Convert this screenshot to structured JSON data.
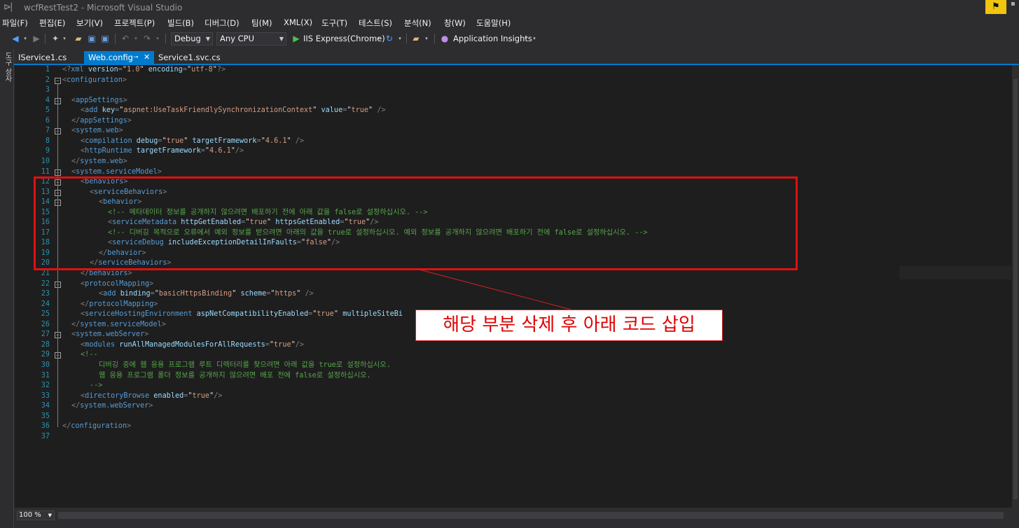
{
  "window": {
    "title": "wcfRestTest2 - Microsoft Visual Studio"
  },
  "menu": [
    "파일(F)",
    "편집(E)",
    "보기(V)",
    "프로젝트(P)",
    "빌드(B)",
    "디버그(D)",
    "팀(M)",
    "XML(X)",
    "도구(T)",
    "테스트(S)",
    "분석(N)",
    "창(W)",
    "도움말(H)"
  ],
  "toolbar": {
    "configuration": "Debug",
    "platform": "Any CPU",
    "run_target": "IIS Express(Chrome)",
    "app_insights": "Application Insights"
  },
  "side_strip": {
    "label": "도구 상자"
  },
  "tabs": [
    {
      "label": "IService1.cs",
      "active": false
    },
    {
      "label": "Web.config",
      "active": true
    },
    {
      "label": "Service1.svc.cs",
      "active": false
    }
  ],
  "editor": {
    "zoom": "100 %",
    "lines": [
      {
        "n": "1",
        "indent": 0,
        "segs": [
          [
            "br",
            "<?"
          ],
          [
            "tag",
            "xml"
          ],
          [
            "pl",
            " "
          ],
          [
            "attr",
            "version"
          ],
          [
            "br",
            "="
          ],
          [
            "pl",
            "\""
          ],
          [
            "val",
            "1.0"
          ],
          [
            "pl",
            "\""
          ],
          [
            "pl",
            " "
          ],
          [
            "attr",
            "encoding"
          ],
          [
            "br",
            "="
          ],
          [
            "pl",
            "\""
          ],
          [
            "val",
            "utf-8"
          ],
          [
            "pl",
            "\""
          ],
          [
            "br",
            "?>"
          ]
        ]
      },
      {
        "n": "2",
        "indent": 0,
        "fold": true,
        "segs": [
          [
            "br",
            "<"
          ],
          [
            "tag",
            "configuration"
          ],
          [
            "br",
            ">"
          ]
        ]
      },
      {
        "n": "3",
        "indent": 0,
        "segs": []
      },
      {
        "n": "4",
        "indent": 1,
        "fold": true,
        "segs": [
          [
            "br",
            "<"
          ],
          [
            "tag",
            "appSettings"
          ],
          [
            "br",
            ">"
          ]
        ]
      },
      {
        "n": "5",
        "indent": 2,
        "segs": [
          [
            "br",
            "<"
          ],
          [
            "tag",
            "add"
          ],
          [
            "pl",
            " "
          ],
          [
            "attr",
            "key"
          ],
          [
            "br",
            "="
          ],
          [
            "pl",
            "\""
          ],
          [
            "val",
            "aspnet:UseTaskFriendlySynchronizationContext"
          ],
          [
            "pl",
            "\""
          ],
          [
            "pl",
            " "
          ],
          [
            "attr",
            "value"
          ],
          [
            "br",
            "="
          ],
          [
            "pl",
            "\""
          ],
          [
            "val",
            "true"
          ],
          [
            "pl",
            "\""
          ],
          [
            "pl",
            " "
          ],
          [
            "br",
            "/>"
          ]
        ]
      },
      {
        "n": "6",
        "indent": 1,
        "segs": [
          [
            "br",
            "</"
          ],
          [
            "tag",
            "appSettings"
          ],
          [
            "br",
            ">"
          ]
        ]
      },
      {
        "n": "7",
        "indent": 1,
        "fold": true,
        "segs": [
          [
            "br",
            "<"
          ],
          [
            "tag",
            "system.web"
          ],
          [
            "br",
            ">"
          ]
        ]
      },
      {
        "n": "8",
        "indent": 2,
        "segs": [
          [
            "br",
            "<"
          ],
          [
            "tag",
            "compilation"
          ],
          [
            "pl",
            " "
          ],
          [
            "attr",
            "debug"
          ],
          [
            "br",
            "="
          ],
          [
            "pl",
            "\""
          ],
          [
            "val",
            "true"
          ],
          [
            "pl",
            "\""
          ],
          [
            "pl",
            " "
          ],
          [
            "attr",
            "targetFramework"
          ],
          [
            "br",
            "="
          ],
          [
            "pl",
            "\""
          ],
          [
            "val",
            "4.6.1"
          ],
          [
            "pl",
            "\""
          ],
          [
            "pl",
            " "
          ],
          [
            "br",
            "/>"
          ]
        ]
      },
      {
        "n": "9",
        "indent": 2,
        "segs": [
          [
            "br",
            "<"
          ],
          [
            "tag",
            "httpRuntime"
          ],
          [
            "pl",
            " "
          ],
          [
            "attr",
            "targetFramework"
          ],
          [
            "br",
            "="
          ],
          [
            "pl",
            "\""
          ],
          [
            "val",
            "4.6.1"
          ],
          [
            "pl",
            "\""
          ],
          [
            "br",
            "/>"
          ]
        ]
      },
      {
        "n": "10",
        "indent": 1,
        "segs": [
          [
            "br",
            "</"
          ],
          [
            "tag",
            "system.web"
          ],
          [
            "br",
            ">"
          ]
        ]
      },
      {
        "n": "11",
        "indent": 1,
        "fold": true,
        "segs": [
          [
            "br",
            "<"
          ],
          [
            "tag",
            "system.serviceModel"
          ],
          [
            "br",
            ">"
          ]
        ]
      },
      {
        "n": "12",
        "indent": 2,
        "fold": true,
        "segs": [
          [
            "br",
            "<"
          ],
          [
            "tag",
            "behaviors"
          ],
          [
            "br",
            ">"
          ]
        ]
      },
      {
        "n": "13",
        "indent": 3,
        "fold": true,
        "segs": [
          [
            "br",
            "<"
          ],
          [
            "tag",
            "serviceBehaviors"
          ],
          [
            "br",
            ">"
          ]
        ]
      },
      {
        "n": "14",
        "indent": 4,
        "fold": true,
        "segs": [
          [
            "br",
            "<"
          ],
          [
            "tag",
            "behavior"
          ],
          [
            "br",
            ">"
          ]
        ]
      },
      {
        "n": "15",
        "indent": 5,
        "segs": [
          [
            "cmt",
            "<!-- 메타데이터 정보를 공개하지 않으려면 배포하기 전에 아래 값을 false로 설정하십시오. -->"
          ]
        ]
      },
      {
        "n": "16",
        "indent": 5,
        "segs": [
          [
            "br",
            "<"
          ],
          [
            "tag",
            "serviceMetadata"
          ],
          [
            "pl",
            " "
          ],
          [
            "attr",
            "httpGetEnabled"
          ],
          [
            "br",
            "="
          ],
          [
            "pl",
            "\""
          ],
          [
            "val",
            "true"
          ],
          [
            "pl",
            "\""
          ],
          [
            "pl",
            " "
          ],
          [
            "attr",
            "httpsGetEnabled"
          ],
          [
            "br",
            "="
          ],
          [
            "pl",
            "\""
          ],
          [
            "val",
            "true"
          ],
          [
            "pl",
            "\""
          ],
          [
            "br",
            "/>"
          ]
        ]
      },
      {
        "n": "17",
        "indent": 5,
        "segs": [
          [
            "cmt",
            "<!-- 디버깅 목적으로 오류에서 예외 정보를 받으려면 아래의 값을 true로 설정하십시오. 예외 정보를 공개하지 않으려면 배포하기 전에 false로 설정하십시오. -->"
          ]
        ]
      },
      {
        "n": "18",
        "indent": 5,
        "segs": [
          [
            "br",
            "<"
          ],
          [
            "tag",
            "serviceDebug"
          ],
          [
            "pl",
            " "
          ],
          [
            "attr",
            "includeExceptionDetailInFaults"
          ],
          [
            "br",
            "="
          ],
          [
            "pl",
            "\""
          ],
          [
            "val",
            "false"
          ],
          [
            "pl",
            "\""
          ],
          [
            "br",
            "/>"
          ]
        ]
      },
      {
        "n": "19",
        "indent": 4,
        "segs": [
          [
            "br",
            "</"
          ],
          [
            "tag",
            "behavior"
          ],
          [
            "br",
            ">"
          ]
        ]
      },
      {
        "n": "20",
        "indent": 3,
        "segs": [
          [
            "br",
            "</"
          ],
          [
            "tag",
            "serviceBehaviors"
          ],
          [
            "br",
            ">"
          ]
        ]
      },
      {
        "n": "21",
        "indent": 2,
        "segs": [
          [
            "br",
            "</"
          ],
          [
            "tag",
            "behaviors"
          ],
          [
            "br",
            ">"
          ]
        ]
      },
      {
        "n": "22",
        "indent": 2,
        "fold": true,
        "segs": [
          [
            "br",
            "<"
          ],
          [
            "tag",
            "protocolMapping"
          ],
          [
            "br",
            ">"
          ]
        ]
      },
      {
        "n": "23",
        "indent": 4,
        "segs": [
          [
            "br",
            "<"
          ],
          [
            "tag",
            "add"
          ],
          [
            "pl",
            " "
          ],
          [
            "attr",
            "binding"
          ],
          [
            "br",
            "="
          ],
          [
            "pl",
            "\""
          ],
          [
            "val",
            "basicHttpsBinding"
          ],
          [
            "pl",
            "\""
          ],
          [
            "pl",
            " "
          ],
          [
            "attr",
            "scheme"
          ],
          [
            "br",
            "="
          ],
          [
            "pl",
            "\""
          ],
          [
            "val",
            "https"
          ],
          [
            "pl",
            "\""
          ],
          [
            "pl",
            " "
          ],
          [
            "br",
            "/>"
          ]
        ]
      },
      {
        "n": "24",
        "indent": 2,
        "segs": [
          [
            "br",
            "</"
          ],
          [
            "tag",
            "protocolMapping"
          ],
          [
            "br",
            ">"
          ]
        ]
      },
      {
        "n": "25",
        "indent": 2,
        "segs": [
          [
            "br",
            "<"
          ],
          [
            "tag",
            "serviceHostingEnvironment"
          ],
          [
            "pl",
            " "
          ],
          [
            "attr",
            "aspNetCompatibilityEnabled"
          ],
          [
            "br",
            "="
          ],
          [
            "pl",
            "\""
          ],
          [
            "val",
            "true"
          ],
          [
            "pl",
            "\""
          ],
          [
            "pl",
            " "
          ],
          [
            "attr",
            "multipleSiteBi"
          ]
        ]
      },
      {
        "n": "26",
        "indent": 1,
        "segs": [
          [
            "br",
            "</"
          ],
          [
            "tag",
            "system.serviceModel"
          ],
          [
            "br",
            ">"
          ]
        ]
      },
      {
        "n": "27",
        "indent": 1,
        "fold": true,
        "segs": [
          [
            "br",
            "<"
          ],
          [
            "tag",
            "system.webServer"
          ],
          [
            "br",
            ">"
          ]
        ]
      },
      {
        "n": "28",
        "indent": 2,
        "segs": [
          [
            "br",
            "<"
          ],
          [
            "tag",
            "modules"
          ],
          [
            "pl",
            " "
          ],
          [
            "attr",
            "runAllManagedModulesForAllRequests"
          ],
          [
            "br",
            "="
          ],
          [
            "pl",
            "\""
          ],
          [
            "val",
            "true"
          ],
          [
            "pl",
            "\""
          ],
          [
            "br",
            "/>"
          ]
        ]
      },
      {
        "n": "29",
        "indent": 2,
        "fold": true,
        "segs": [
          [
            "cmt",
            "<!--"
          ]
        ]
      },
      {
        "n": "30",
        "indent": 4,
        "segs": [
          [
            "cmt",
            "디버깅 중에 웹 응용 프로그램 루트 디렉터리를 찾으려면 아래 값을 true로 설정하십시오."
          ]
        ]
      },
      {
        "n": "31",
        "indent": 4,
        "segs": [
          [
            "cmt",
            "웹 응용 프로그램 폴더 정보를 공개하지 않으려면 배포 전에 false로 설정하십시오."
          ]
        ]
      },
      {
        "n": "32",
        "indent": 3,
        "segs": [
          [
            "cmt",
            "-->"
          ]
        ]
      },
      {
        "n": "33",
        "indent": 2,
        "segs": [
          [
            "br",
            "<"
          ],
          [
            "tag",
            "directoryBrowse"
          ],
          [
            "pl",
            " "
          ],
          [
            "attr",
            "enabled"
          ],
          [
            "br",
            "="
          ],
          [
            "pl",
            "\""
          ],
          [
            "val",
            "true"
          ],
          [
            "pl",
            "\""
          ],
          [
            "br",
            "/>"
          ]
        ]
      },
      {
        "n": "34",
        "indent": 1,
        "segs": [
          [
            "br",
            "</"
          ],
          [
            "tag",
            "system.webServer"
          ],
          [
            "br",
            ">"
          ]
        ]
      },
      {
        "n": "35",
        "indent": 0,
        "segs": []
      },
      {
        "n": "36",
        "indent": 0,
        "segs": [
          [
            "br",
            "</"
          ],
          [
            "tag",
            "configuration"
          ],
          [
            "br",
            ">"
          ]
        ]
      },
      {
        "n": "37",
        "indent": 0,
        "segs": []
      }
    ]
  },
  "annotation": {
    "callout_text": "해당 부분 삭제 후 아래 코드 삽입",
    "color": "#e01010"
  }
}
